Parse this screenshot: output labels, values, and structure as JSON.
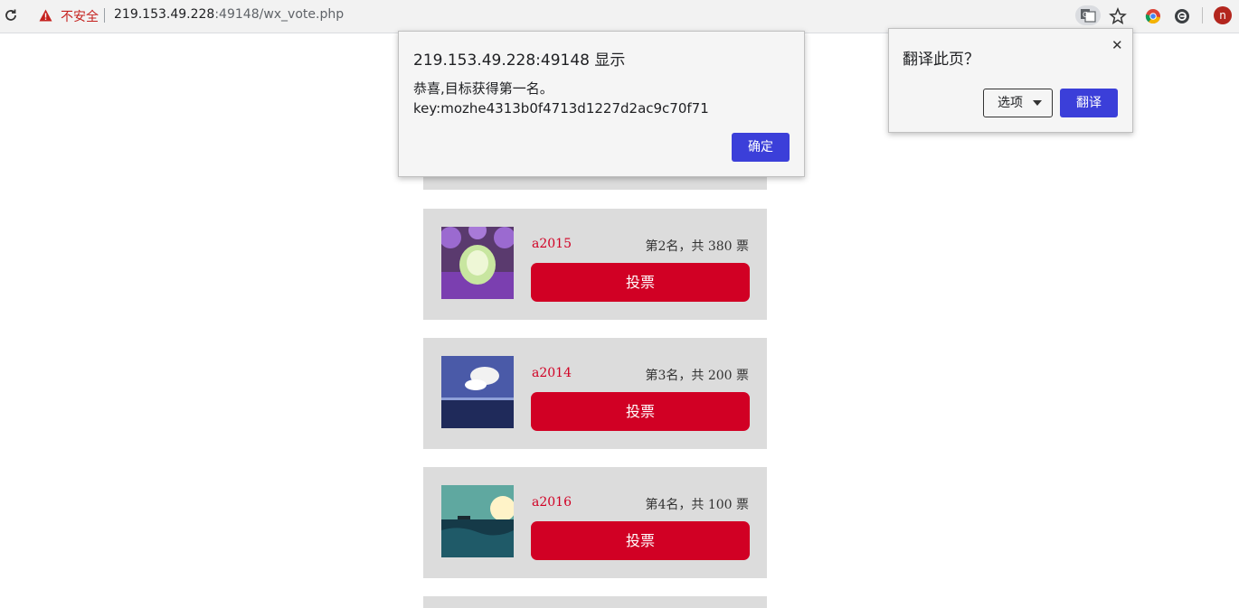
{
  "browser": {
    "security_label": "不安全",
    "url_host": "219.153.49.228",
    "url_path": ":49148/wx_vote.php",
    "profile_initial": "n"
  },
  "alert": {
    "title": "219.153.49.228:49148 显示",
    "message_line1": "恭喜,目标获得第一名。",
    "message_line2": "key:mozhe4313b0f4713d1227d2ac9c70f71",
    "ok_label": "确定"
  },
  "translate_popup": {
    "title": "翻译此页？",
    "options_label": "选项",
    "translate_label": "翻译"
  },
  "candidates": [
    {
      "name": "a2015",
      "rank_text": "第2名，共 380 票",
      "vote_label": "投票"
    },
    {
      "name": "a2014",
      "rank_text": "第3名，共 200 票",
      "vote_label": "投票"
    },
    {
      "name": "a2016",
      "rank_text": "第4名，共 100 票",
      "vote_label": "投票"
    }
  ]
}
